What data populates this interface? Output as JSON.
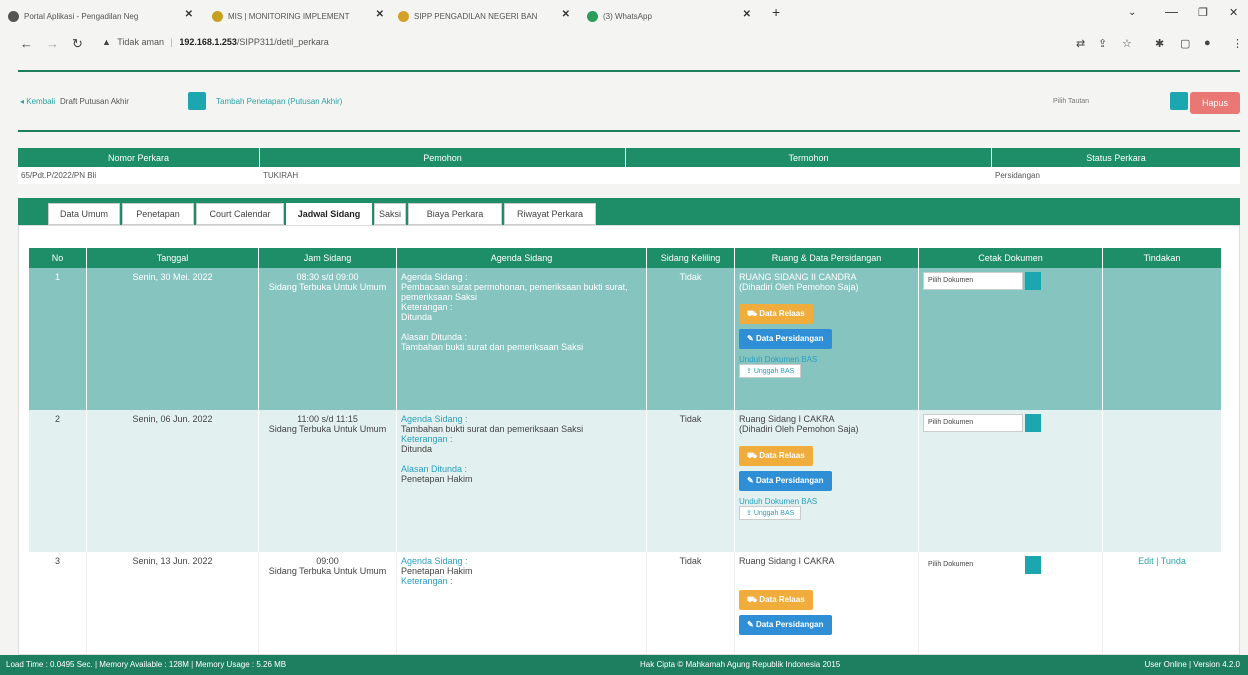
{
  "browser": {
    "tabs": [
      {
        "title": "Portal Aplikasi - Pengadilan Neg",
        "color": "#555555"
      },
      {
        "title": "MIS | MONITORING IMPLEMENT",
        "color": "#c8a020"
      },
      {
        "title": "SIPP PENGADILAN NEGERI BAN",
        "color": "#d4a028"
      },
      {
        "title": "(3) WhatsApp",
        "color": "#2a9d5a"
      }
    ],
    "new_tab": "+",
    "url_warning": "Tidak aman",
    "url_host": "192.168.1.253",
    "url_path": "/SIPP311/detil_perkara"
  },
  "toolbar": {
    "kembali": "Kembali",
    "draft_label": "Draft Putusan Akhir",
    "tambah_link": "Tambah Penetapan (Putusan Akhir)",
    "pilih_tautan": "Pilih Tautan",
    "hapus": "Hapus"
  },
  "info_table": {
    "headers": [
      "Nomor Perkara",
      "Pemohon",
      "Termohon",
      "Status Perkara"
    ],
    "row": [
      "65/Pdt.P/2022/PN Bli",
      "TUKIRAH",
      "",
      "Persidangan"
    ]
  },
  "tabs": [
    "Data Umum",
    "Penetapan",
    "Court Calendar",
    "Jadwal Sidang",
    "Saksi",
    "Biaya Perkara",
    "Riwayat Perkara"
  ],
  "active_tab": "Jadwal Sidang",
  "grid": {
    "headers": [
      "No",
      "Tanggal",
      "Jam Sidang",
      "Agenda Sidang",
      "Sidang Keliling",
      "Ruang & Data Persidangan",
      "Cetak Dokumen",
      "Tindakan"
    ],
    "labels": {
      "agenda": "Agenda Sidang :",
      "keterangan": "Keterangan :",
      "alasan": "Alasan Ditunda :",
      "data_relaas": "Data Relaas",
      "data_persidangan": "Data Persidangan",
      "unduh": "Unduh Dokumen BAS",
      "unggah": "Unggah BAS",
      "pilih_dokumen": "Pilih Dokumen"
    },
    "rows": [
      {
        "no": "1",
        "tanggal": "Senin, 30 Mei. 2022",
        "jam": "08:30 s/d 09:00",
        "jenis": "Sidang Terbuka Untuk Umum",
        "agenda": "Pembacaan surat permohonan, pemeriksaan bukti surat, pemeriksaan Saksi",
        "keterangan": "Ditunda",
        "alasan": "Tambahan bukti surat dan pemeriksaan Saksi",
        "keliling": "Tidak",
        "ruang": "RUANG SIDANG II CANDRA",
        "dihadiri": "(Dihadiri Oleh Pemohon Saja)",
        "tindakan": ""
      },
      {
        "no": "2",
        "tanggal": "Senin, 06 Jun. 2022",
        "jam": "11:00 s/d 11:15",
        "jenis": "Sidang Terbuka Untuk Umum",
        "agenda": "Tambahan bukti surat dan pemeriksaan Saksi",
        "keterangan": "Ditunda",
        "alasan": "Penetapan Hakim",
        "keliling": "Tidak",
        "ruang": "Ruang Sidang I CAKRA",
        "dihadiri": "(Dihadiri Oleh Pemohon Saja)",
        "tindakan": ""
      },
      {
        "no": "3",
        "tanggal": "Senin, 13 Jun. 2022",
        "jam": "09:00",
        "jenis": "Sidang Terbuka Untuk Umum",
        "agenda": "Penetapan Hakim",
        "keterangan": "",
        "alasan": "",
        "keliling": "Tidak",
        "ruang": "Ruang Sidang I CAKRA",
        "dihadiri": "",
        "tindakan": "Edit | Tunda"
      }
    ]
  },
  "footer": {
    "left": "Load Time : 0.0495 Sec. | Memory Available : 128M | Memory Usage : 5.26 MB",
    "center": "Hak Cipta © Mahkamah Agung Republik Indonesia 2015",
    "right": "User Online | Version 4.2.0"
  },
  "colors": {
    "green": "#1e8e68",
    "teal_row": "#86c4c0",
    "light_row": "#e2f1ef",
    "hapus": "#e97774"
  }
}
